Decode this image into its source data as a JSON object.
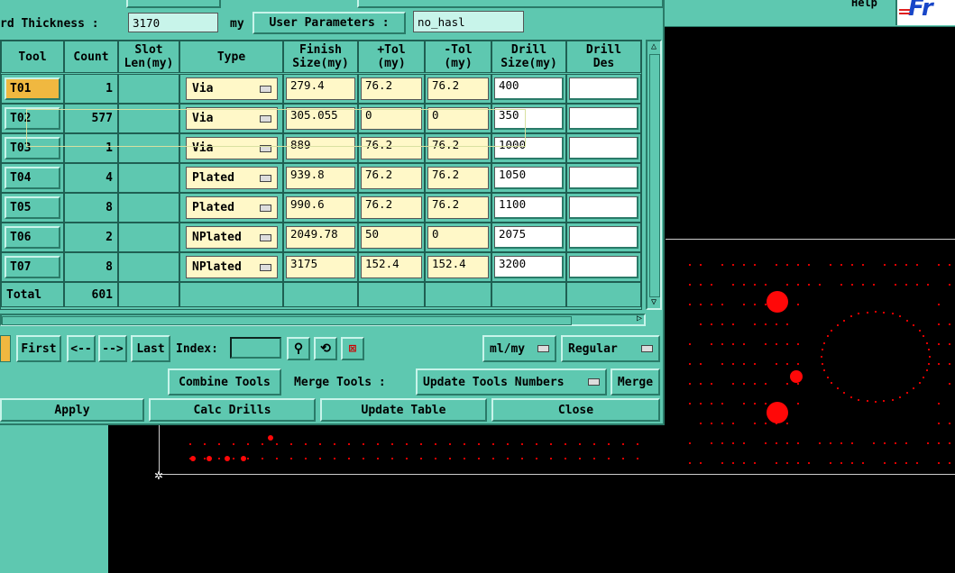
{
  "header": {
    "thickness_label": "rd Thickness :",
    "thickness_value": "3170",
    "thickness_unit": "my",
    "user_params_label": "User Parameters :",
    "user_params_value": "no_hasl",
    "help_label": "Help"
  },
  "logo_text": "Fr",
  "table": {
    "columns": [
      "Tool",
      "Count",
      "Slot\nLen(my)",
      "Type",
      "Finish\nSize(my)",
      "+Tol\n(my)",
      "-Tol\n(my)",
      "Drill\nSize(my)",
      "Drill\nDes"
    ],
    "rows": [
      {
        "tool": "T01",
        "count": "1",
        "type": "Via",
        "finish": "279.4",
        "ptol": "76.2",
        "ntol": "76.2",
        "drill": "400",
        "des": ""
      },
      {
        "tool": "T02",
        "count": "577",
        "type": "Via",
        "finish": "305.055",
        "ptol": "0",
        "ntol": "0",
        "drill": "350",
        "des": ""
      },
      {
        "tool": "T03",
        "count": "1",
        "type": "Via",
        "finish": "889",
        "ptol": "76.2",
        "ntol": "76.2",
        "drill": "1000",
        "des": ""
      },
      {
        "tool": "T04",
        "count": "4",
        "type": "Plated",
        "finish": "939.8",
        "ptol": "76.2",
        "ntol": "76.2",
        "drill": "1050",
        "des": ""
      },
      {
        "tool": "T05",
        "count": "8",
        "type": "Plated",
        "finish": "990.6",
        "ptol": "76.2",
        "ntol": "76.2",
        "drill": "1100",
        "des": ""
      },
      {
        "tool": "T06",
        "count": "2",
        "type": "NPlated",
        "finish": "2049.78",
        "ptol": "50",
        "ntol": "0",
        "drill": "2075",
        "des": ""
      },
      {
        "tool": "T07",
        "count": "8",
        "type": "NPlated",
        "finish": "3175",
        "ptol": "152.4",
        "ntol": "152.4",
        "drill": "3200",
        "des": ""
      }
    ],
    "total_label": "Total",
    "total_count": "601"
  },
  "nav": {
    "first": "First",
    "prev": "<--",
    "next": "-->",
    "last": "Last",
    "index_label": "Index:",
    "index_value": "",
    "units_option": "ml/my",
    "mode_option": "Regular"
  },
  "tools_row": {
    "combine": "Combine Tools",
    "merge_label": "Merge Tools :",
    "merge_option": "Update Tools Numbers",
    "merge_button": "Merge"
  },
  "actions": {
    "apply": "Apply",
    "calc": "Calc Drills",
    "update": "Update Table",
    "close": "Close"
  },
  "colors": {
    "dialog": "#5ec8b0",
    "highlight_tool": "#f0b840",
    "drill_dot": "#ff0808",
    "canvas": "#000000"
  }
}
